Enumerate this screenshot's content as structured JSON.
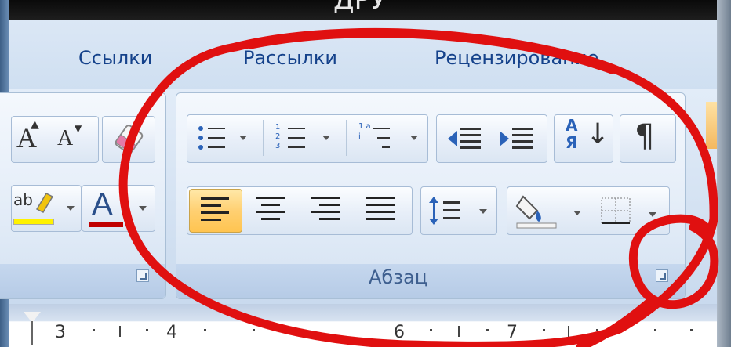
{
  "window": {
    "title_fragment": "ДРУ"
  },
  "tabs": [
    {
      "label": "Ссылки"
    },
    {
      "label": "Рассылки"
    },
    {
      "label": "Рецензирование"
    }
  ],
  "font_group": {
    "grow_font_icon": "grow-font-icon",
    "shrink_font_icon": "shrink-font-icon",
    "clear_format_icon": "clear-formatting-icon",
    "highlight_icon": "highlight-icon",
    "font_color_icon": "font-color-icon",
    "highlight_label": "ab"
  },
  "paragraph_group": {
    "label": "Абзац",
    "buttons": {
      "bullets": "bullets-icon",
      "numbering_label": "1 2 3",
      "multilevel_label": "1 a i",
      "decrease_indent": "decrease-indent-icon",
      "increase_indent": "increase-indent-icon",
      "sort_label": "А Я",
      "show_marks_label": "¶",
      "align_left": "align-left-icon",
      "align_center": "align-center-icon",
      "align_right": "align-right-icon",
      "justify": "justify-icon",
      "line_spacing": "line-spacing-icon",
      "shading": "shading-icon",
      "borders": "borders-icon"
    }
  },
  "ruler": {
    "numbers": [
      "3",
      "4",
      "6",
      "7"
    ]
  },
  "colors": {
    "annotation": "#e01010",
    "ribbon_text": "#15428b",
    "active_button": "#ffd072"
  }
}
